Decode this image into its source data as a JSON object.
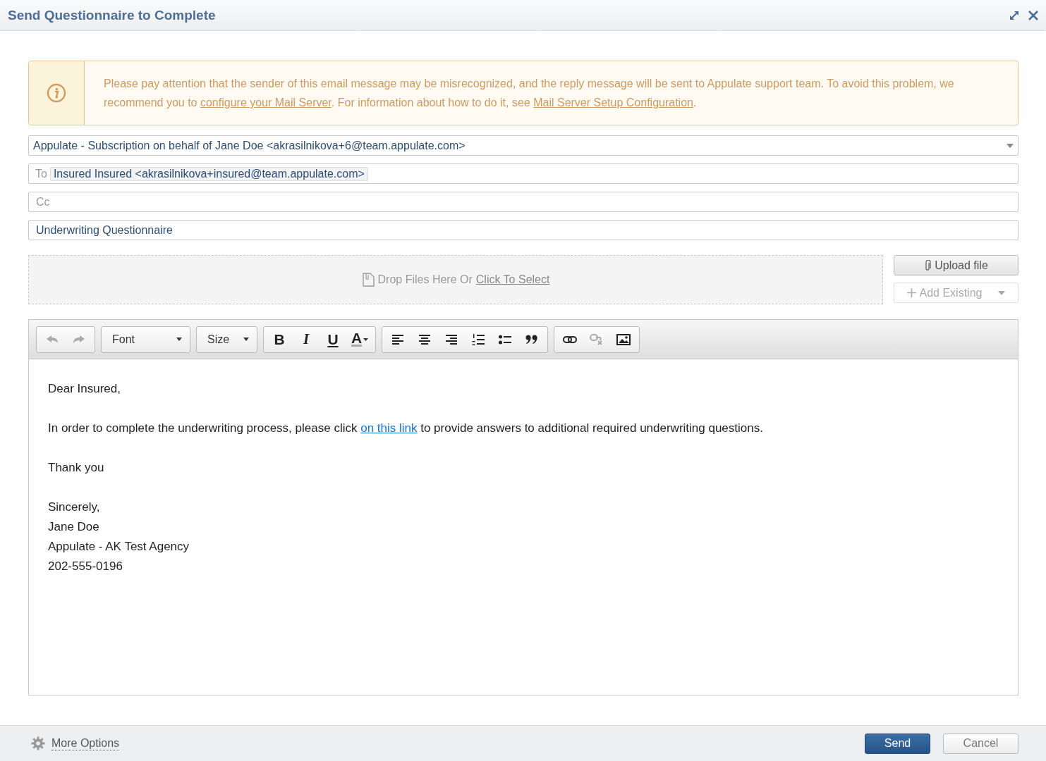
{
  "window": {
    "title": "Send Questionnaire to Complete"
  },
  "warning": {
    "text_1": "Please pay attention that the sender of this email message may be misrecognized, and the reply message will be sent to Appulate support team. To avoid this problem, we recommend you to ",
    "link_1": "configure your Mail Server",
    "text_2": ". For information about how to do it, see ",
    "link_2": "Mail Server Setup Configuration",
    "text_3": "."
  },
  "from": {
    "value": "Appulate - Subscription on behalf of Jane Doe <akrasilnikova+6@team.appulate.com>"
  },
  "to": {
    "label": "To",
    "recipients": [
      "Insured Insured <akrasilnikova+insured@team.appulate.com>"
    ]
  },
  "cc": {
    "placeholder": "Cc"
  },
  "subject": {
    "value": "Underwriting Questionnaire"
  },
  "dropzone": {
    "text": "Drop Files Here Or",
    "link": "Click To Select"
  },
  "upload_button": {
    "label": "Upload file"
  },
  "add_existing_button": {
    "label": "Add Existing",
    "disabled": true
  },
  "toolbar": {
    "groups": [
      {
        "items": [
          {
            "kind": "undo",
            "disabled": true
          },
          {
            "kind": "redo",
            "disabled": true
          }
        ]
      },
      {
        "items": [
          {
            "kind": "dropdown",
            "label": "Font"
          }
        ]
      },
      {
        "items": [
          {
            "kind": "dropdown",
            "label": "Size"
          }
        ]
      },
      {
        "items": [
          {
            "kind": "bold",
            "label": "B",
            "disabled": false
          },
          {
            "kind": "italic",
            "label": "I",
            "disabled": false
          },
          {
            "kind": "underline",
            "label": "U",
            "disabled": false
          },
          {
            "kind": "color",
            "label": "A",
            "disabled": false
          }
        ]
      },
      {
        "items": [
          {
            "kind": "align-left",
            "disabled": false
          },
          {
            "kind": "align-center",
            "disabled": false
          },
          {
            "kind": "align-right",
            "disabled": false
          },
          {
            "kind": "ordered-list",
            "disabled": false
          },
          {
            "kind": "bullet-list",
            "disabled": false
          },
          {
            "kind": "quote",
            "disabled": false
          }
        ]
      },
      {
        "items": [
          {
            "kind": "link",
            "disabled": false
          },
          {
            "kind": "unlink",
            "disabled": true
          },
          {
            "kind": "image",
            "disabled": false
          }
        ]
      }
    ]
  },
  "body": {
    "paragraphs": [
      {
        "kind": "text",
        "lines": [
          "Dear Insured,"
        ]
      },
      {
        "kind": "linked",
        "before": "In order to complete the underwriting process, please click ",
        "link": "on this link",
        "after": " to provide answers to additional required underwriting questions."
      },
      {
        "kind": "text",
        "lines": [
          "Thank you"
        ]
      },
      {
        "kind": "text",
        "lines": [
          "Sincerely,",
          "Jane Doe",
          "Appulate - AK Test Agency",
          "202-555-0196"
        ]
      }
    ]
  },
  "footer": {
    "more_options": "More Options",
    "send": "Send",
    "cancel": "Cancel"
  }
}
